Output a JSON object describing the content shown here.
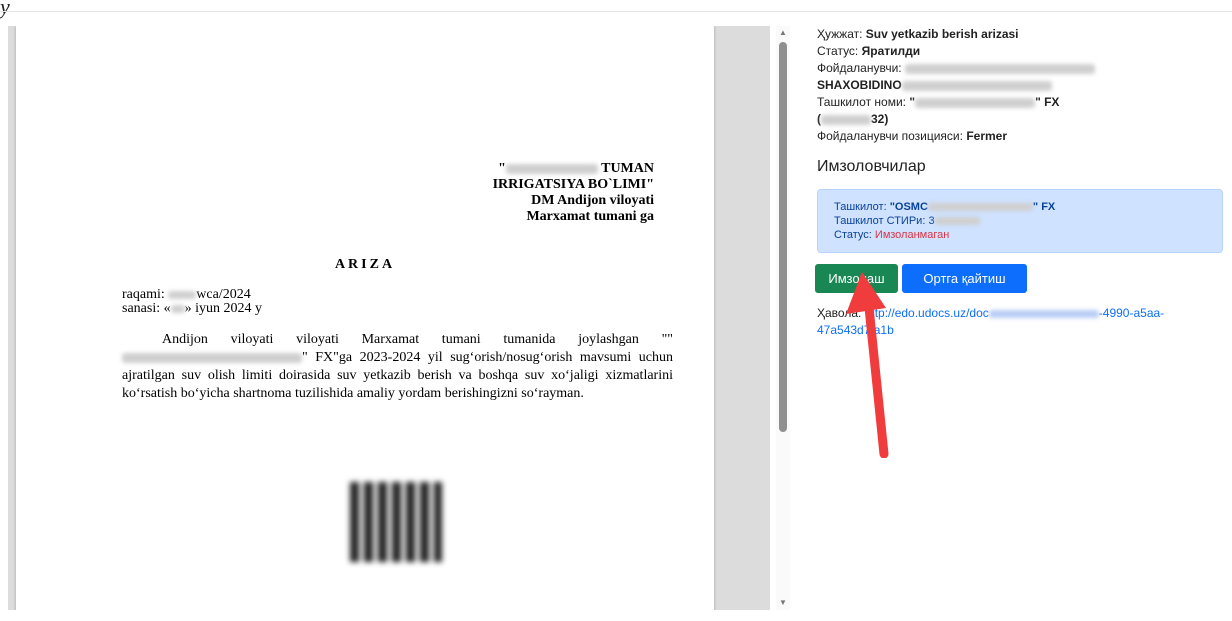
{
  "corner_glyph": "y",
  "document": {
    "addressee": {
      "line1_prefix": "\"",
      "line1_suffix": "TUMAN",
      "line2": "IRRIGATSIYA BO`LIMI\"",
      "line3": "DM Andijon viloyati",
      "line4": "Marxamat tumani  ga"
    },
    "title": "ARIZA",
    "number_label": "raqami:",
    "number_suffix": "wca/2024",
    "date_label": "sanasi:  «",
    "date_suffix": "» iyun 2024 y",
    "body_part1": "Andijon viloyati viloyati Marxamat tumani tumanida joylashgan \"\"",
    "body_part2": "\" FX\"ga 2023-2024 yil sug‘orish/nosug‘orish mavsumi uchun ajratilgan suv olish limiti doirasida suv yetkazib berish va boshqa suv xo‘jaligi xizmatlarini ko‘rsatish bo‘yicha shartnoma tuzilishida amaliy yordam berishingizni so‘rayman."
  },
  "info": {
    "doc_label": "Ҳужжат:",
    "doc_value": "Suv yetkazib berish arizasi",
    "status_label": "Статус:",
    "status_value": "Яратилди",
    "user_label": "Фойдаланувчи:",
    "user_name": "SHAXOBIDINO",
    "org_label": "Ташкилот номи:",
    "org_value_prefix": "\"",
    "org_value_suffix": "\" FX",
    "org_id_prefix": "(",
    "org_id_suffix": "32)",
    "position_label": "Фойдаланувчи позицияси:",
    "position_value": "Fermer"
  },
  "signers": {
    "title": "Имзоловчилар",
    "org_label": "Ташкилот:",
    "org_value_prefix": "\"OSMC",
    "org_value_suffix": "\" FX",
    "inn_label": "Ташкилот СТИРи:",
    "inn_value": "3",
    "status_label": "Статус:",
    "status_value": "Имзоланмаган"
  },
  "buttons": {
    "sign": "Имзолаш",
    "back": "Ортга қайтиш"
  },
  "link": {
    "label": "Ҳавола:",
    "url_part1": "http://edo.udocs.uz/doc",
    "url_part2": "-4990-a5aa-47a543d7fa1b"
  },
  "colors": {
    "sign_button": "#198754",
    "back_button": "#0d6efd",
    "signer_card_bg": "#cfe2ff",
    "status_unsigned": "#dc3545",
    "annotation_arrow": "#f03c3c"
  }
}
